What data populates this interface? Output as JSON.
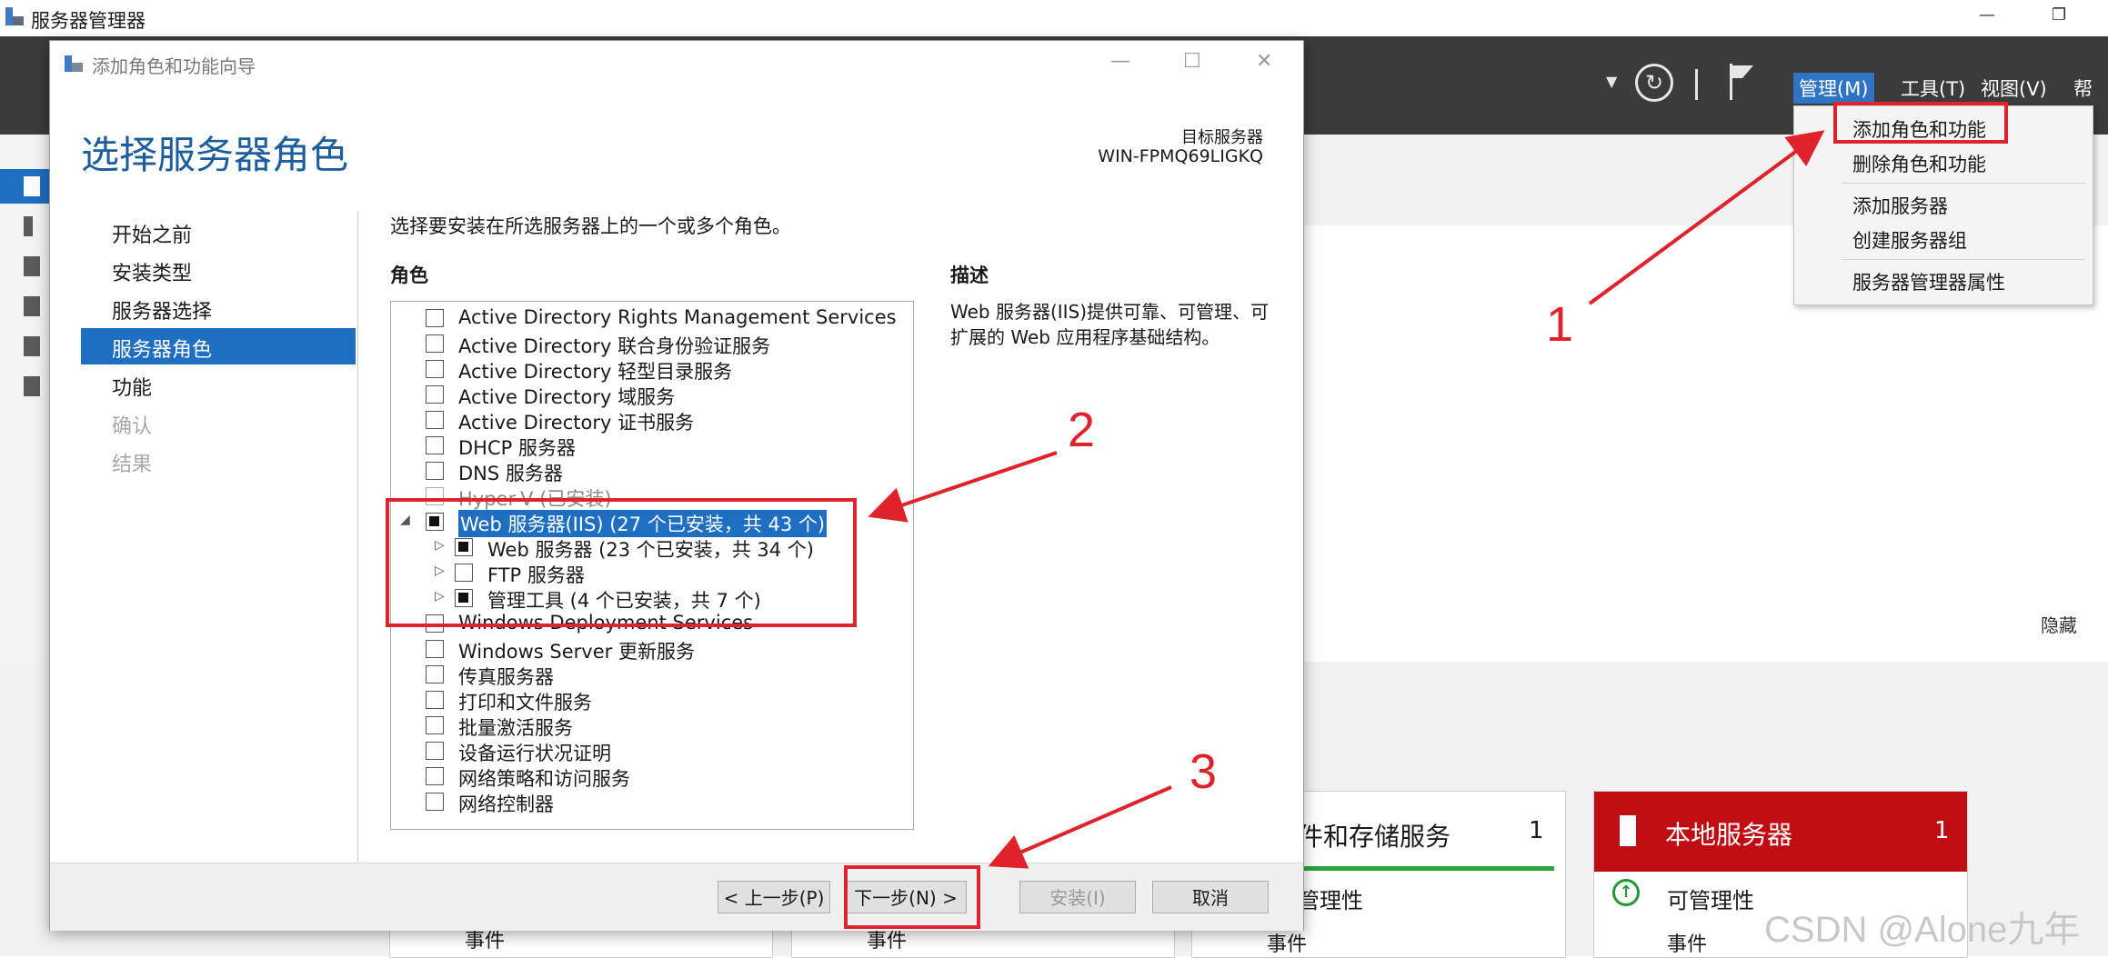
{
  "app": {
    "title": "服务器管理器"
  },
  "menubar": {
    "manage": "管理(M)",
    "tools": "工具(T)",
    "view": "视图(V)",
    "help": "帮助"
  },
  "manage_menu": {
    "items": [
      "添加角色和功能",
      "删除角色和功能",
      "添加服务器",
      "创建服务器组",
      "服务器管理器属性"
    ]
  },
  "content": {
    "hide": "隐藏",
    "tiles": [
      {
        "title": "件和存储服务",
        "count": "1",
        "manageability": "管理性",
        "events": "事件"
      },
      {
        "title": "本地服务器",
        "count": "1",
        "manageability": "可管理性",
        "events": "事件"
      }
    ],
    "events_labels": [
      "事件",
      "事件",
      "事件",
      "事件"
    ]
  },
  "wizard": {
    "title": "添加角色和功能向导",
    "heading": "选择服务器角色",
    "destination_label": "目标服务器",
    "destination_name": "WIN-FPMQ69LIGKQ",
    "steps": [
      "开始之前",
      "安装类型",
      "服务器选择",
      "服务器角色",
      "功能",
      "确认",
      "结果"
    ],
    "active_step": "服务器角色",
    "instruction": "选择要安装在所选服务器上的一个或多个角色。",
    "roles_label": "角色",
    "description_label": "描述",
    "description_text": "Web 服务器(IIS)提供可靠、可管理、可扩展的 Web 应用程序基础结构。",
    "roles": [
      {
        "label": "Active Directory Rights Management Services",
        "state": "unchecked",
        "level": 0
      },
      {
        "label": "Active Directory 联合身份验证服务",
        "state": "unchecked",
        "level": 0
      },
      {
        "label": "Active Directory 轻型目录服务",
        "state": "unchecked",
        "level": 0
      },
      {
        "label": "Active Directory 域服务",
        "state": "unchecked",
        "level": 0
      },
      {
        "label": "Active Directory 证书服务",
        "state": "unchecked",
        "level": 0
      },
      {
        "label": "DHCP 服务器",
        "state": "unchecked",
        "level": 0
      },
      {
        "label": "DNS 服务器",
        "state": "unchecked",
        "level": 0
      },
      {
        "label": "Hyper-V (已安装)",
        "state": "installed",
        "level": 0
      },
      {
        "label": "Web 服务器(IIS) (27 个已安装，共 43 个)",
        "state": "partial",
        "level": 0,
        "expanded": true,
        "selected": true
      },
      {
        "label": "Web 服务器 (23 个已安装，共 34 个)",
        "state": "partial",
        "level": 1,
        "expandable": true
      },
      {
        "label": "FTP 服务器",
        "state": "unchecked",
        "level": 1,
        "expandable": true
      },
      {
        "label": "管理工具 (4 个已安装，共 7 个)",
        "state": "partial",
        "level": 1,
        "expandable": true
      },
      {
        "label": "Windows Deployment Services",
        "state": "unchecked",
        "level": 0
      },
      {
        "label": "Windows Server 更新服务",
        "state": "unchecked",
        "level": 0
      },
      {
        "label": "传真服务器",
        "state": "unchecked",
        "level": 0
      },
      {
        "label": "打印和文件服务",
        "state": "unchecked",
        "level": 0
      },
      {
        "label": "批量激活服务",
        "state": "unchecked",
        "level": 0
      },
      {
        "label": "设备运行状况证明",
        "state": "unchecked",
        "level": 0
      },
      {
        "label": "网络策略和访问服务",
        "state": "unchecked",
        "level": 0
      },
      {
        "label": "网络控制器",
        "state": "unchecked",
        "level": 0
      }
    ],
    "buttons": {
      "prev": "< 上一步(P)",
      "next": "下一步(N) >",
      "install": "安装(I)",
      "cancel": "取消"
    }
  },
  "annotations": {
    "labels": [
      "1",
      "2",
      "3"
    ],
    "color": "#e0222a"
  },
  "watermark": "CSDN @Alone九年"
}
